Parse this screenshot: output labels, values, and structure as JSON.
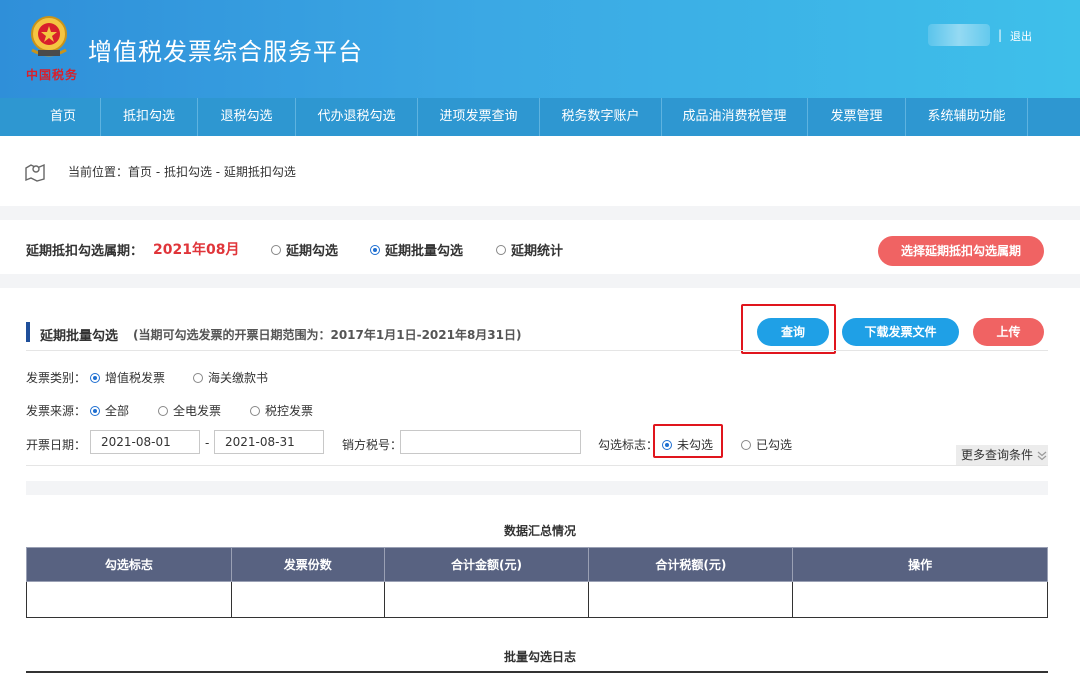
{
  "header": {
    "title": "增值税发票综合服务平台",
    "emblem_text": "中国税务",
    "logout_label": "退出",
    "separator": "|",
    "emblem_icon": "tax-emblem-icon"
  },
  "nav": {
    "items": [
      {
        "label": "首页"
      },
      {
        "label": "抵扣勾选"
      },
      {
        "label": "退税勾选"
      },
      {
        "label": "代办退税勾选"
      },
      {
        "label": "进项发票查询"
      },
      {
        "label": "税务数字账户"
      },
      {
        "label": "成品油消费税管理"
      },
      {
        "label": "发票管理"
      },
      {
        "label": "系统辅助功能"
      }
    ]
  },
  "breadcrumb": {
    "prefix": "当前位置：",
    "path": "首页 - 抵扣勾选 - 延期抵扣勾选",
    "icon": "map-location-icon"
  },
  "period": {
    "label": "延期抵扣勾选属期：",
    "value": "2021年08月",
    "options": [
      {
        "label": "延期勾选",
        "selected": false
      },
      {
        "label": "延期批量勾选",
        "selected": true
      },
      {
        "label": "延期统计",
        "selected": false
      }
    ],
    "select_button": "选择延期抵扣勾选属期"
  },
  "section": {
    "title": "延期批量勾选",
    "note": "(当期可勾选发票的开票日期范围为：2017年1月1日-2021年8月31日)",
    "query_button": "查询",
    "download_button": "下载发票文件",
    "upload_button": "上传"
  },
  "form": {
    "invoice_type": {
      "label": "发票类别：",
      "options": [
        {
          "label": "增值税发票",
          "selected": true
        },
        {
          "label": "海关缴款书",
          "selected": false
        }
      ]
    },
    "invoice_source": {
      "label": "发票来源：",
      "options": [
        {
          "label": "全部",
          "selected": true
        },
        {
          "label": "全电发票",
          "selected": false
        },
        {
          "label": "税控发票",
          "selected": false
        }
      ]
    },
    "date": {
      "label": "开票日期：",
      "from": "2021-08-01",
      "separator": "-",
      "to": "2021-08-31"
    },
    "seller_tax_id": {
      "label": "销方税号：",
      "value": ""
    },
    "check_flag": {
      "label": "勾选标志：",
      "options": [
        {
          "label": "未勾选",
          "selected": true
        },
        {
          "label": "已勾选",
          "selected": false
        }
      ]
    },
    "more_label": "更多查询条件",
    "more_icon": "double-chevron-down-icon"
  },
  "summary": {
    "caption": "数据汇总情况",
    "columns": [
      "勾选标志",
      "发票份数",
      "合计金额(元)",
      "合计税额(元)",
      "操作"
    ],
    "rows": [
      [
        "",
        "",
        "",
        "",
        ""
      ]
    ]
  },
  "log": {
    "caption": "批量勾选日志"
  },
  "colors": {
    "header_gradient_start": "#2f8fd9",
    "header_gradient_end": "#3ec0ea",
    "nav_bg": "#2e97d1",
    "accent_red": "#e0353a",
    "button_blue": "#1fa0e6",
    "button_red": "#f06363",
    "table_header": "#586281",
    "highlight_box": "#e0151d"
  }
}
